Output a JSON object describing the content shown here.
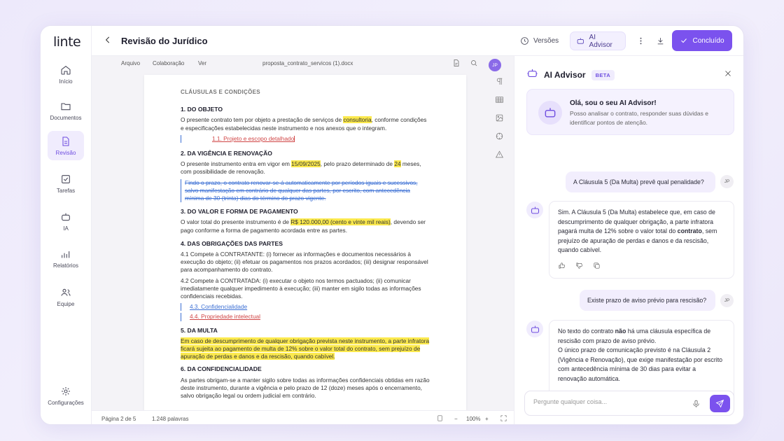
{
  "app": {
    "logo": "linte"
  },
  "rail": {
    "items": [
      {
        "label": "Início",
        "icon": "home-icon"
      },
      {
        "label": "Documentos",
        "icon": "folder-icon"
      },
      {
        "label": "Revisão",
        "icon": "file-edit-icon",
        "active": true
      },
      {
        "label": "Tarefas",
        "icon": "checkbox-icon"
      },
      {
        "label": "IA",
        "icon": "bot-icon"
      },
      {
        "label": "Relatórios",
        "icon": "chart-icon"
      },
      {
        "label": "Equipe",
        "icon": "users-icon"
      }
    ],
    "settings_label": "Configurações"
  },
  "header": {
    "title": "Revisão do Jurídico",
    "versions_label": "Versões",
    "ai_label": "AI Advisor",
    "done_label": "Concluído"
  },
  "editor": {
    "menu": [
      "Arquivo",
      "Colaboração",
      "Ver"
    ],
    "filename": "proposta_contrato_servicos (1).docx",
    "avatar": "JP",
    "status": {
      "page": "Página 2 de 5",
      "words": "1.248 palavras",
      "zoom": "100%"
    }
  },
  "doc": {
    "kicker": "CLÁUSULAS E CONDIÇÕES",
    "s1": {
      "title": "1. DO OBJETO",
      "p_a": "O presente contrato tem por objeto a prestação de serviços de ",
      "p_hl": "consultoria",
      "p_b": ", conforme condições e especificações estabelecidas neste instrumento e nos anexos que o integram.",
      "ins": "1.1. Projeto e escopo detalhado"
    },
    "s2": {
      "title": "2. DA VIGÊNCIA E RENOVAÇÃO",
      "p_a": "O presente instrumento entra em vigor em ",
      "p_date": "15/09/2025",
      "p_b": ", pelo prazo determinado de ",
      "p_num": "24",
      "p_c": " meses, com possibilidade de renovação.",
      "del": "Findo o prazo, o contrato renovar-se-á automaticamente por períodos iguais e sucessivos, salvo manifestação em contrário de qualquer das partes, por escrito, com antecedência mínima de 30 (trinta) dias do término do prazo vigente."
    },
    "s3": {
      "title": "3. DO VALOR E FORMA DE PAGAMENTO",
      "p_a": "O valor total do presente instrumento é de ",
      "p_hl": "R$ 120.000,00 (cento e vinte mil reais)",
      "p_b": ", devendo ser pago conforme a forma de pagamento acordada entre as partes."
    },
    "s4": {
      "title": "4. DAS OBRIGAÇÕES DAS PARTES",
      "p1": "4.1 Compete à CONTRATANTE: (i) fornecer as informações e documentos necessários à execução do objeto; (ii) efetuar os pagamentos nos prazos acordados; (iii) designar responsável para acompanhamento do contrato.",
      "p2": "4.2 Compete à CONTRATADA: (i) executar o objeto nos termos pactuados; (ii) comunicar imediatamente qualquer impedimento à execução; (iii) manter em sigilo todas as informações confidenciais recebidas.",
      "ins": "4.3. Confidencialidade",
      "red": "4.4. Propriedade intelectual"
    },
    "s5": {
      "title": "5. DA MULTA",
      "p": "Em caso de descumprimento de qualquer obrigação prevista neste instrumento, a parte infratora ficará sujeita ao pagamento de multa de 12% sobre o valor total do contrato, sem prejuízo de apuração de perdas e danos e da rescisão, quando cabível."
    },
    "s6": {
      "title": "6. DA CONFIDENCIALIDADE",
      "p": "As partes obrigam-se a manter sigilo sobre todas as informações confidenciais obtidas em razão deste instrumento, durante a vigência e pelo prazo de 12 (doze) meses após o encerramento, salvo obrigação legal ou ordem judicial em contrário."
    }
  },
  "advisor": {
    "title": "AI Advisor",
    "badge": "BETA",
    "welcome_title": "Olá, sou o seu AI Advisor!",
    "welcome_desc": "Posso analisar o contrato, responder suas dúvidas e identificar pontos de atenção.",
    "user_avatar": "JP",
    "q1": "A Cláusula 5 (Da Multa) prevê qual penalidade?",
    "a1_pre": "Sim. A Cláusula 5 (Da Multa) estabelece que, em caso de descumprimento de qualquer obrigação, a parte infratora pagará multa de 12% sobre o valor total do ",
    "a1_bold": "contrato",
    "a1_post": ", sem prejuízo de apuração de perdas e danos e da rescisão, quando cabível.",
    "q2": "Existe prazo de aviso prévio para rescisão?",
    "a2_pre": "No texto do contrato ",
    "a2_bold": "não",
    "a2_mid": " há uma cláusula específica de rescisão com prazo de aviso prévio.",
    "a2_p2": "O único prazo de comunicação previsto é na Cláusula 2 (Vigência e Renovação), que exige manifestação por escrito com antecedência mínima de 30 dias para evitar a renovação automática.",
    "placeholder": "Pergunte qualquer coisa..."
  },
  "colors": {
    "accent": "#7b52ee",
    "highlight": "#fbe94d",
    "insert": "#3b6fd4",
    "delete": "#d04545"
  }
}
